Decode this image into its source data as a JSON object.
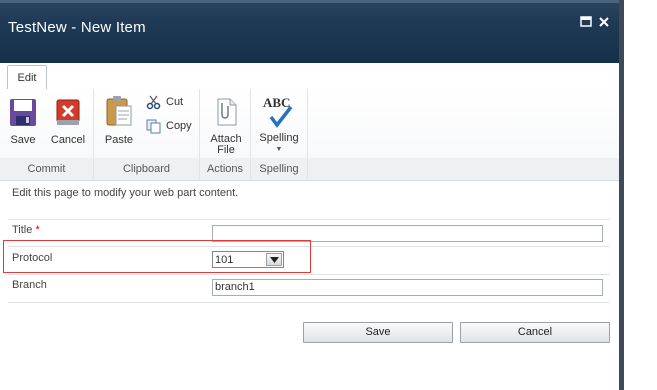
{
  "window": {
    "title": "TestNew - New Item"
  },
  "ribbon": {
    "tab": "Edit",
    "groups": {
      "commit": {
        "label": "Commit",
        "save": "Save",
        "cancel": "Cancel"
      },
      "clipboard": {
        "label": "Clipboard",
        "paste": "Paste",
        "cut": "Cut",
        "copy": "Copy"
      },
      "actions": {
        "label": "Actions",
        "attach_line1": "Attach",
        "attach_line2": "File"
      },
      "spelling": {
        "label": "Spelling",
        "spelling": "Spelling",
        "abc": "ABC"
      }
    }
  },
  "form": {
    "intro": "Edit this page to modify your web part content.",
    "title_label": "Title",
    "required_mark": "*",
    "title_value": "",
    "protocol_label": "Protocol",
    "protocol_value": "101",
    "branch_label": "Branch",
    "branch_value": "branch1"
  },
  "buttons": {
    "save": "Save",
    "cancel": "Cancel"
  },
  "colors": {
    "titlebar": "#1f3a56",
    "highlight": "#e03a3a",
    "required": "#cc0000"
  },
  "icons": [
    "maximize-icon",
    "close-icon",
    "save-icon",
    "cancel-icon",
    "paste-icon",
    "cut-icon",
    "copy-icon",
    "attach-file-icon",
    "spelling-icon"
  ]
}
